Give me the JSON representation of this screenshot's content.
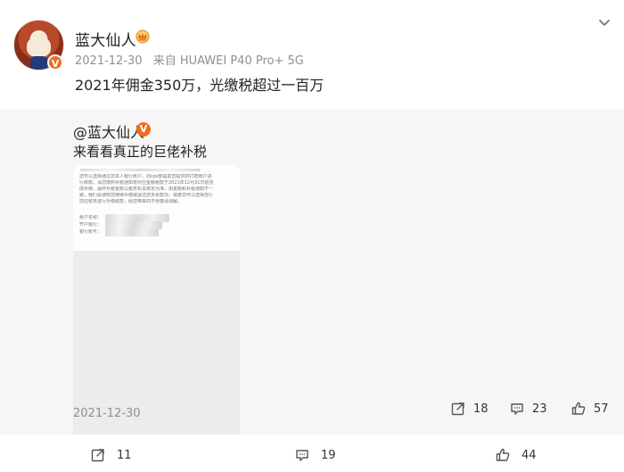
{
  "post": {
    "username": "蓝大仙人",
    "date": "2021-12-30",
    "device": "来自 HUAWEI P40 Pro+ 5G",
    "text": "2021年佣金350万，光缴税超过一百万",
    "verified_badge": "V"
  },
  "repost": {
    "author": "@蓝大仙人",
    "verified_badge": "V",
    "text": "来看看真正的巨佬补税",
    "image_doc_lines": [
      "您可以选择通过您本人银行账户，向cps部提前您提供的打款账户进",
      "行转款。请您按照补税通知将对应金额税款于2021年12月31日前完",
      "成补缴，最终补税金额以税务机关核定为准，如金额和补税通知不一",
      "致，我们会通知您继续补缴或退还您多余款项，或者您可以选择自行",
      "前往税务进行补缴税款，给您带来的不便敬请谅解。"
    ],
    "image_fields": [
      "账户名称：",
      "开户银行：",
      "银行账号："
    ],
    "date": "2021-12-30",
    "shares": "18",
    "comments": "23",
    "likes": "57"
  },
  "actions": {
    "shares": "11",
    "comments": "19",
    "likes": "44"
  },
  "icons": {
    "crown": "crown-icon",
    "chevron": "chevron-down-icon",
    "share": "share-icon",
    "comment": "comment-icon",
    "like": "thumbs-up-icon"
  },
  "colors": {
    "accent_orange": "#f06c1e",
    "text_primary": "#222222",
    "text_muted": "#8f8f8f",
    "repost_background": "#f6f6f6"
  }
}
